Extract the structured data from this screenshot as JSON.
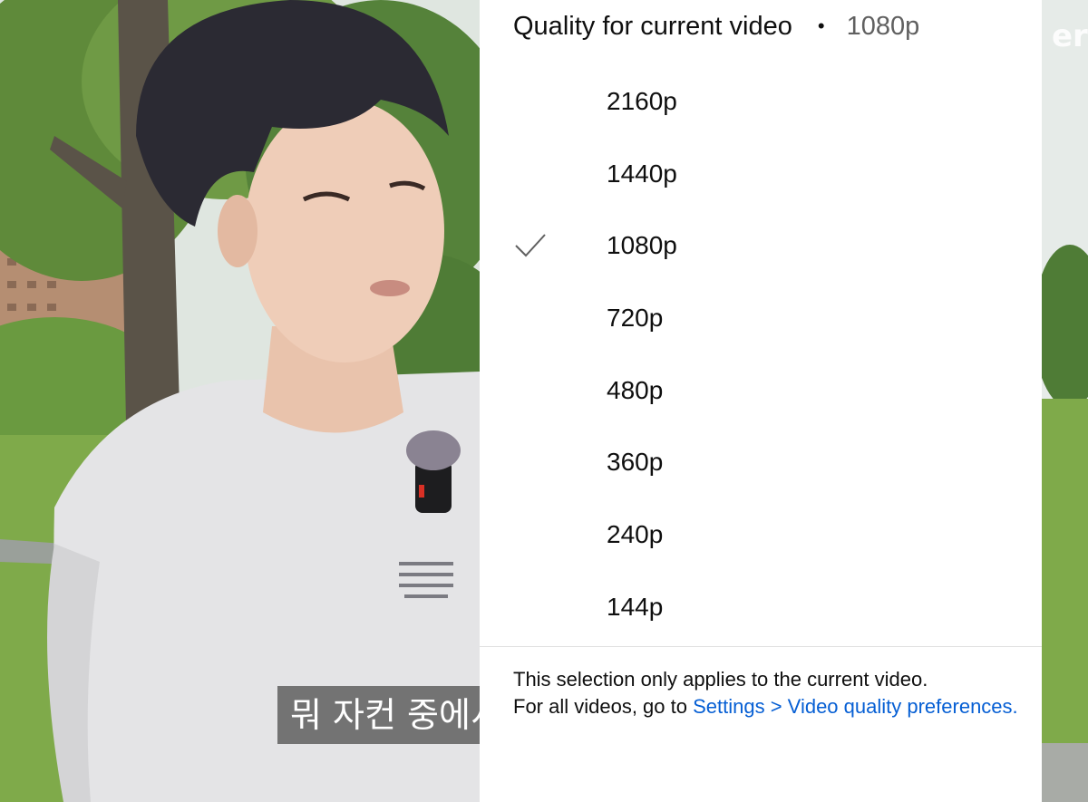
{
  "video": {
    "caption": "뭐 자컨 중에서",
    "partial_overlay_text": "er"
  },
  "quality_menu": {
    "header_title": "Quality for current video",
    "header_separator": "•",
    "header_current": "1080p",
    "selected": "1080p",
    "options": [
      {
        "label": "2160p",
        "selected": false
      },
      {
        "label": "1440p",
        "selected": false
      },
      {
        "label": "1080p",
        "selected": true
      },
      {
        "label": "720p",
        "selected": false
      },
      {
        "label": "480p",
        "selected": false
      },
      {
        "label": "360p",
        "selected": false
      },
      {
        "label": "240p",
        "selected": false
      },
      {
        "label": "144p",
        "selected": false
      }
    ],
    "footer_line1": "This selection only applies to the current video.",
    "footer_line2_prefix": "For all videos, go to ",
    "footer_link": "Settings > Video quality preferences."
  },
  "icons": {
    "check": "checkmark-icon"
  },
  "colors": {
    "link": "#065fd4",
    "panel_bg": "#ffffff",
    "secondary_text": "#606060"
  }
}
